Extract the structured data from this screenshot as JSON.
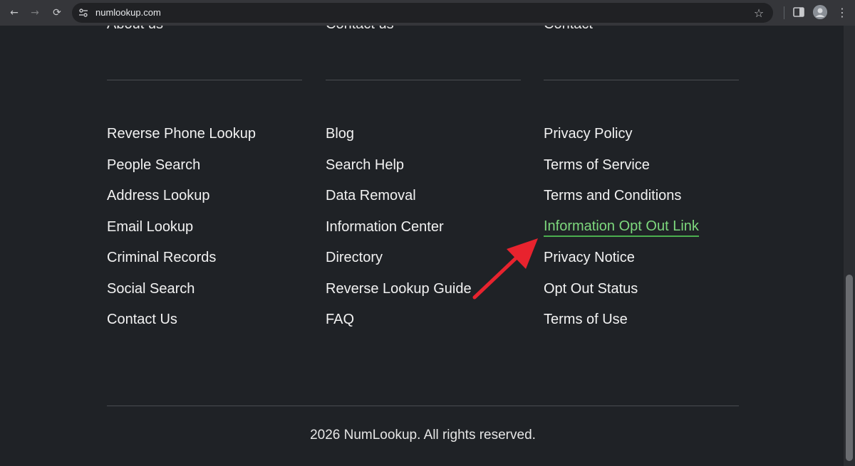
{
  "browser": {
    "url": "numlookup.com",
    "back_icon": "←",
    "forward_icon": "→",
    "reload_icon": "⟳",
    "star_icon": "☆",
    "menu_icon": "⋮"
  },
  "footer": {
    "cut_headings": [
      "About us",
      "Contact us",
      "Contact"
    ],
    "columns": [
      {
        "links": [
          "Reverse Phone Lookup",
          "People Search",
          "Address Lookup",
          "Email Lookup",
          "Criminal Records",
          "Social Search",
          "Contact Us"
        ]
      },
      {
        "links": [
          "Blog",
          "Search Help",
          "Data Removal",
          "Information Center",
          "Directory",
          "Reverse Lookup Guide",
          "FAQ"
        ]
      },
      {
        "links": [
          "Privacy Policy",
          "Terms of Service",
          "Terms and Conditions",
          "Information Opt Out Link",
          "Privacy Notice",
          "Opt Out Status",
          "Terms of Use"
        ]
      }
    ],
    "copyright": "2026 NumLookup. All rights reserved."
  },
  "colors": {
    "background": "#1f2226",
    "highlight_link": "#7dd87d",
    "annotation_arrow": "#e8232e"
  }
}
